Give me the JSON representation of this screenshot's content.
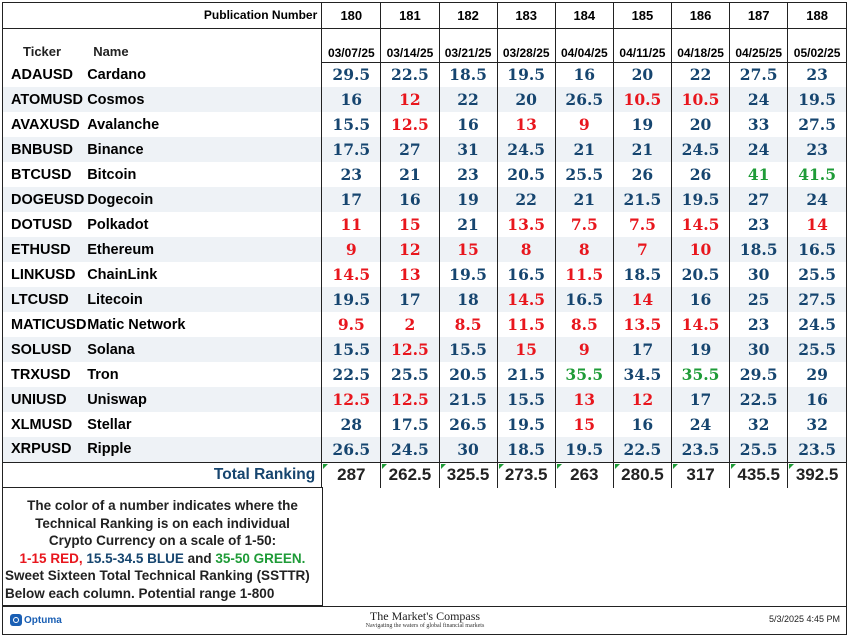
{
  "header": {
    "publication_label": "Publication Number",
    "publications": [
      "180",
      "181",
      "182",
      "183",
      "184",
      "185",
      "186",
      "187",
      "188"
    ],
    "ticker_label": "Ticker",
    "name_label": "Name",
    "dates": [
      "03/07/25",
      "03/14/25",
      "03/21/25",
      "03/28/25",
      "04/04/25",
      "04/11/25",
      "04/18/25",
      "04/25/25",
      "05/02/25"
    ]
  },
  "rows": [
    {
      "ticker": "ADAUSD",
      "name": "Cardano",
      "values": [
        "29.5",
        "22.5",
        "18.5",
        "19.5",
        "16",
        "20",
        "22",
        "27.5",
        "23"
      ]
    },
    {
      "ticker": "ATOMUSD",
      "name": "Cosmos",
      "values": [
        "16",
        "12",
        "22",
        "20",
        "26.5",
        "10.5",
        "10.5",
        "24",
        "19.5"
      ]
    },
    {
      "ticker": "AVAXUSD",
      "name": "Avalanche",
      "values": [
        "15.5",
        "12.5",
        "16",
        "13",
        "9",
        "19",
        "20",
        "33",
        "27.5"
      ]
    },
    {
      "ticker": "BNBUSD",
      "name": "Binance",
      "values": [
        "17.5",
        "27",
        "31",
        "24.5",
        "21",
        "21",
        "24.5",
        "24",
        "23"
      ]
    },
    {
      "ticker": "BTCUSD",
      "name": "Bitcoin",
      "values": [
        "23",
        "21",
        "23",
        "20.5",
        "25.5",
        "26",
        "26",
        "41",
        "41.5"
      ]
    },
    {
      "ticker": "DOGEUSD",
      "name": "Dogecoin",
      "values": [
        "17",
        "16",
        "19",
        "22",
        "21",
        "21.5",
        "19.5",
        "27",
        "24"
      ]
    },
    {
      "ticker": "DOTUSD",
      "name": "Polkadot",
      "values": [
        "11",
        "15",
        "21",
        "13.5",
        "7.5",
        "7.5",
        "14.5",
        "23",
        "14"
      ]
    },
    {
      "ticker": "ETHUSD",
      "name": "Ethereum",
      "values": [
        "9",
        "12",
        "15",
        "8",
        "8",
        "7",
        "10",
        "18.5",
        "16.5"
      ]
    },
    {
      "ticker": "LINKUSD",
      "name": "ChainLink",
      "values": [
        "14.5",
        "13",
        "19.5",
        "16.5",
        "11.5",
        "18.5",
        "20.5",
        "30",
        "25.5"
      ]
    },
    {
      "ticker": "LTCUSD",
      "name": "Litecoin",
      "values": [
        "19.5",
        "17",
        "18",
        "14.5",
        "16.5",
        "14",
        "16",
        "25",
        "27.5"
      ]
    },
    {
      "ticker": "MATICUSD",
      "name": "Matic Network",
      "values": [
        "9.5",
        "2",
        "8.5",
        "11.5",
        "8.5",
        "13.5",
        "14.5",
        "23",
        "24.5"
      ]
    },
    {
      "ticker": "SOLUSD",
      "name": "Solana",
      "values": [
        "15.5",
        "12.5",
        "15.5",
        "15",
        "9",
        "17",
        "19",
        "30",
        "25.5"
      ]
    },
    {
      "ticker": "TRXUSD",
      "name": "Tron",
      "values": [
        "22.5",
        "25.5",
        "20.5",
        "21.5",
        "35.5",
        "34.5",
        "35.5",
        "29.5",
        "29"
      ]
    },
    {
      "ticker": "UNIUSD",
      "name": "Uniswap",
      "values": [
        "12.5",
        "12.5",
        "21.5",
        "15.5",
        "13",
        "12",
        "17",
        "22.5",
        "16"
      ]
    },
    {
      "ticker": "XLMUSD",
      "name": "Stellar",
      "values": [
        "28",
        "17.5",
        "26.5",
        "19.5",
        "15",
        "16",
        "24",
        "32",
        "32"
      ]
    },
    {
      "ticker": "XRPUSD",
      "name": "Ripple",
      "values": [
        "26.5",
        "24.5",
        "30",
        "18.5",
        "19.5",
        "22.5",
        "23.5",
        "25.5",
        "23.5"
      ]
    }
  ],
  "total": {
    "label": "Total Ranking",
    "values": [
      "287",
      "262.5",
      "325.5",
      "273.5",
      "263",
      "280.5",
      "317",
      "435.5",
      "392.5"
    ]
  },
  "colors": {
    "red": "#e8161d",
    "blue": "#16456f",
    "green": "#1e9b37"
  },
  "legend": {
    "line1": "The color of a number indicates where the",
    "line2": "Technical Ranking is on each individual",
    "line3": "Crypto Currency on a scale of 1-50:",
    "red_text": "1-15 RED,",
    "blue_text": " 15.5-34.5 BLUE",
    "and_text": " and ",
    "green_text": "35-50 GREEN.",
    "line5": "Sweet Sixteen Total Technical Ranking (SSTTR)",
    "line6": "Below each column.   Potential range 1-800"
  },
  "footer": {
    "brand": "Optuma",
    "title": "The Market's Compass",
    "subtitle": "Navigating the waters of global financial markets",
    "timestamp": "5/3/2025 4:45 PM"
  }
}
